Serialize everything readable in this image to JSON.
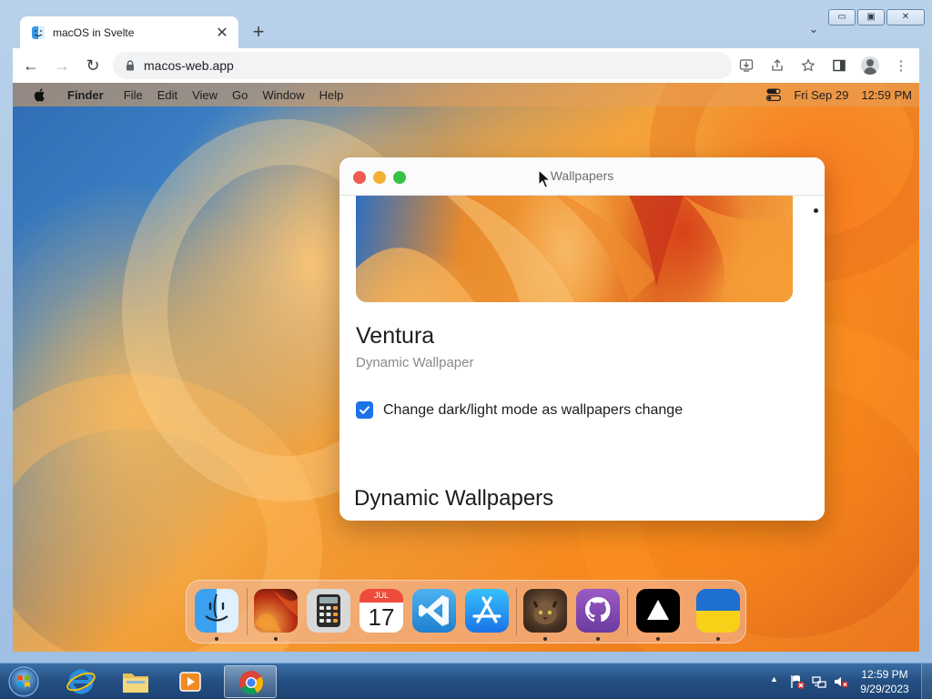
{
  "browser": {
    "tab": {
      "title": "macOS in Svelte",
      "close_glyph": "✕"
    },
    "new_tab_glyph": "+",
    "tab_search_glyph": "⌄",
    "window_controls": {
      "minimize": "▭",
      "maximize": "▣",
      "close": "✕"
    },
    "toolbar": {
      "back_glyph": "←",
      "forward_glyph": "→",
      "reload_glyph": "↻",
      "url": "macos-web.app",
      "menu_glyph": "⋮"
    }
  },
  "macos": {
    "menubar": {
      "app_name": "Finder",
      "menus": [
        "File",
        "Edit",
        "View",
        "Go",
        "Window",
        "Help"
      ],
      "date": "Fri Sep 29",
      "time": "12:59 PM"
    },
    "wallpapers_window": {
      "title": "Wallpapers",
      "wallpaper_name": "Ventura",
      "wallpaper_type": "Dynamic Wallpaper",
      "checkbox_label": "Change dark/light mode as wallpapers change",
      "checkbox_checked": true,
      "section_title": "Dynamic Wallpapers"
    },
    "dock": {
      "apps": [
        {
          "name": "Finder",
          "icon": "finder-icon"
        },
        {
          "name": "Wallpapers",
          "icon": "wallpapers-icon"
        },
        {
          "name": "Calculator",
          "icon": "calculator-icon"
        },
        {
          "name": "Calendar",
          "icon": "calendar-icon",
          "month": "JUL",
          "day": "17"
        },
        {
          "name": "VS Code",
          "icon": "vscode-icon"
        },
        {
          "name": "App Store",
          "icon": "app-store-icon"
        },
        {
          "name": "Purus Twitter",
          "icon": "cat-photo-icon"
        },
        {
          "name": "GitHub",
          "icon": "github-icon"
        },
        {
          "name": "Vercel",
          "icon": "vercel-icon"
        },
        {
          "name": "Ukraine",
          "icon": "ukraine-flag-icon"
        }
      ]
    }
  },
  "taskbar": {
    "clock_time": "12:59 PM",
    "clock_date": "9/29/2023",
    "tray_arrow": "▲"
  },
  "colors": {
    "accent_blue": "#1a73e8",
    "traffic_red": "#ee5b53",
    "traffic_yellow": "#f2b131",
    "traffic_green": "#36c247"
  }
}
